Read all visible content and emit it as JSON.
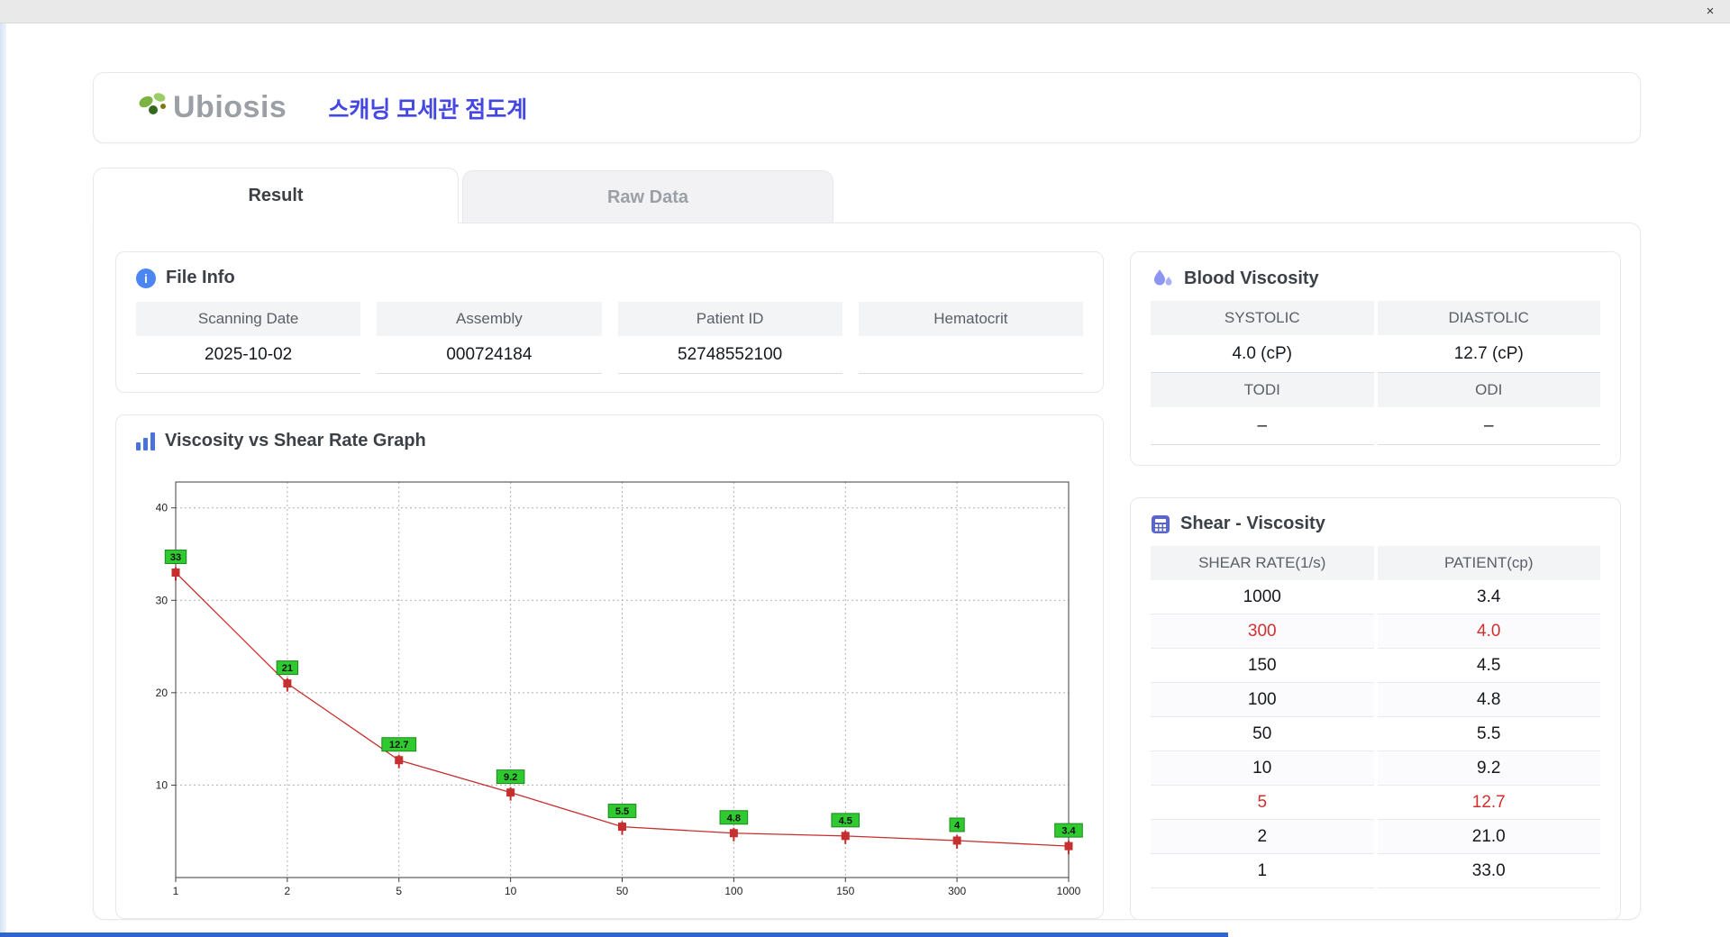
{
  "window": {
    "close_glyph": "×"
  },
  "header": {
    "logo_text": "Ubiosis",
    "app_title": "스캐닝 모세관 점도계"
  },
  "tabs": [
    {
      "label": "Result",
      "active": true
    },
    {
      "label": "Raw Data",
      "active": false
    }
  ],
  "file_info": {
    "title": "File Info",
    "fields": [
      {
        "label": "Scanning Date",
        "value": "2025-10-02"
      },
      {
        "label": "Assembly",
        "value": "000724184"
      },
      {
        "label": "Patient ID",
        "value": "52748552100"
      },
      {
        "label": "Hematocrit",
        "value": ""
      }
    ]
  },
  "graph": {
    "title": "Viscosity vs Shear Rate Graph"
  },
  "chart_data": {
    "type": "line",
    "title": "Viscosity vs Shear Rate Graph",
    "x_labels": [
      "1",
      "2",
      "5",
      "10",
      "50",
      "100",
      "150",
      "300",
      "1000"
    ],
    "x_spacing": "even-categorical",
    "values": [
      33,
      21,
      12.7,
      9.2,
      5.5,
      4.8,
      4.5,
      4,
      3.4
    ],
    "point_labels": [
      "33",
      "21",
      "12.7",
      "9.2",
      "5.5",
      "4.8",
      "4.5",
      "4",
      "3.4"
    ],
    "y_ticks": [
      10,
      20,
      30,
      40
    ],
    "ylim": [
      0,
      42.8
    ],
    "xlabel": "",
    "ylabel": "",
    "grid": "dotted",
    "line_color": "#c62f2f",
    "marker_color": "#c62f2f",
    "point_label_bg": "#2fca2f",
    "point_label_border": "#1d861d"
  },
  "blood_viscosity": {
    "title": "Blood Viscosity",
    "rows": [
      {
        "cells": [
          {
            "label": "SYSTOLIC",
            "value": "4.0 (cP)"
          },
          {
            "label": "DIASTOLIC",
            "value": "12.7 (cP)"
          }
        ]
      },
      {
        "cells": [
          {
            "label": "TODI",
            "value": "–"
          },
          {
            "label": "ODI",
            "value": "–"
          }
        ]
      }
    ]
  },
  "shear_viscosity": {
    "title": "Shear - Viscosity",
    "columns": [
      "SHEAR RATE(1/s)",
      "PATIENT(cp)"
    ],
    "rows": [
      {
        "shear": "1000",
        "patient": "3.4",
        "highlight": false
      },
      {
        "shear": "300",
        "patient": "4.0",
        "highlight": true
      },
      {
        "shear": "150",
        "patient": "4.5",
        "highlight": false
      },
      {
        "shear": "100",
        "patient": "4.8",
        "highlight": false
      },
      {
        "shear": "50",
        "patient": "5.5",
        "highlight": false
      },
      {
        "shear": "10",
        "patient": "9.2",
        "highlight": false
      },
      {
        "shear": "5",
        "patient": "12.7",
        "highlight": true
      },
      {
        "shear": "2",
        "patient": "21.0",
        "highlight": false
      },
      {
        "shear": "1",
        "patient": "33.0",
        "highlight": false
      }
    ]
  },
  "colors": {
    "accent_blue": "#4547e2",
    "highlight_red": "#d03030",
    "tab_inactive_text": "#9aa0a6"
  }
}
